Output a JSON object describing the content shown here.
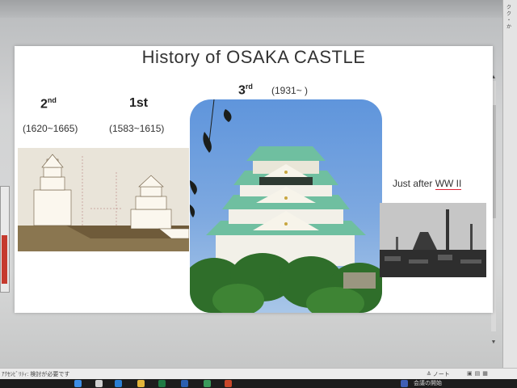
{
  "slide": {
    "title": "History of OSAKA CASTLE",
    "second": {
      "num": "2",
      "suffix": "nd",
      "years": "(1620~1665)"
    },
    "first": {
      "label": "1st",
      "years": "(1583~1615)"
    },
    "third": {
      "num": "3",
      "suffix": "rd",
      "years": "(1931~ )"
    },
    "ww_label": {
      "text": "Just after ",
      "underlined": "WW II"
    }
  },
  "side_panel": {
    "text": "ク\nク\n・\nか"
  },
  "statusbar": {
    "text": "ｱｸｾｼﾋﾞﾘﾃｨ: 検討が必要です",
    "notes": "≙ ノート"
  },
  "taskbar": {
    "text": "会議の開始"
  },
  "colors": {
    "accent_underline": "#d23",
    "slide_bg": "#ffffff",
    "sky": "#6a9ee0",
    "roof_green": "#6fbfa0"
  }
}
